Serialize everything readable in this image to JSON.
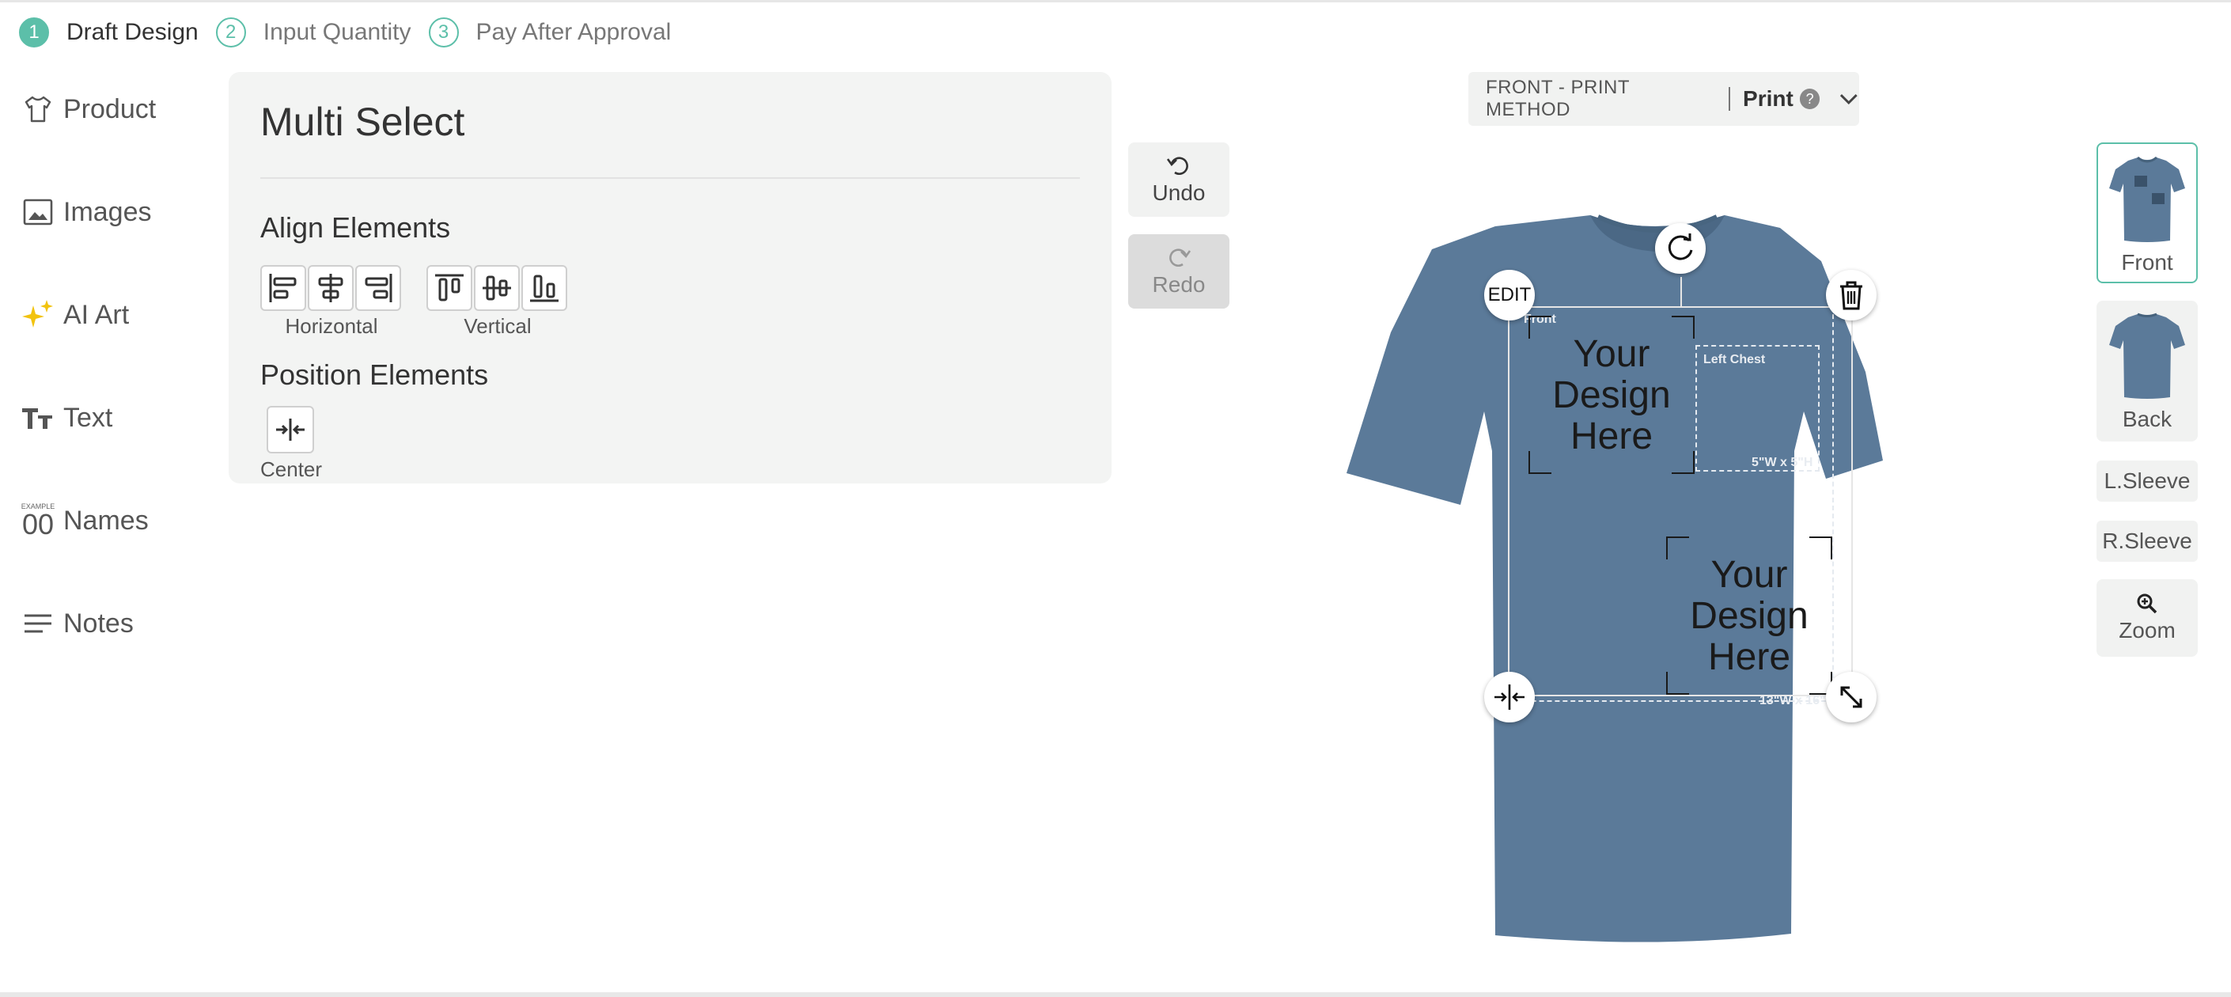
{
  "steps": [
    {
      "num": "1",
      "label": "Draft Design"
    },
    {
      "num": "2",
      "label": "Input Quantity"
    },
    {
      "num": "3",
      "label": "Pay After Approval"
    }
  ],
  "sidebar": {
    "items": [
      {
        "label": "Product",
        "icon": "tshirt-icon"
      },
      {
        "label": "Images",
        "icon": "image-icon"
      },
      {
        "label": "AI Art",
        "icon": "sparkle-icon"
      },
      {
        "label": "Text",
        "icon": "text-icon"
      },
      {
        "label": "Names",
        "icon": "names-icon",
        "icon_text": "EXAMPLE",
        "icon_num": "00"
      },
      {
        "label": "Notes",
        "icon": "notes-icon"
      }
    ]
  },
  "panel": {
    "title": "Multi Select",
    "align_heading": "Align Elements",
    "horizontal_label": "Horizontal",
    "vertical_label": "Vertical",
    "position_heading": "Position Elements",
    "center_label": "Center"
  },
  "history": {
    "undo_label": "Undo",
    "redo_label": "Redo"
  },
  "print_method": {
    "caption": "FRONT - PRINT METHOD",
    "value": "Print",
    "help": "?"
  },
  "canvas": {
    "edit_label": "EDIT",
    "front_area_label": "Front",
    "left_chest_label": "Left Chest",
    "left_chest_size": "5\"W x 5\"H",
    "front_size": "13\"W x 16\"H",
    "design_placeholder_1": "Your Design Here",
    "design_placeholder_2": "Your Design Here"
  },
  "views": {
    "front": "Front",
    "back": "Back",
    "left_sleeve": "L.Sleeve",
    "right_sleeve": "R.Sleeve",
    "zoom": "Zoom"
  },
  "colors": {
    "accent": "#5cbfa9",
    "shirt": "#5b7a99",
    "ai_art_icon": "#f2c30e"
  }
}
